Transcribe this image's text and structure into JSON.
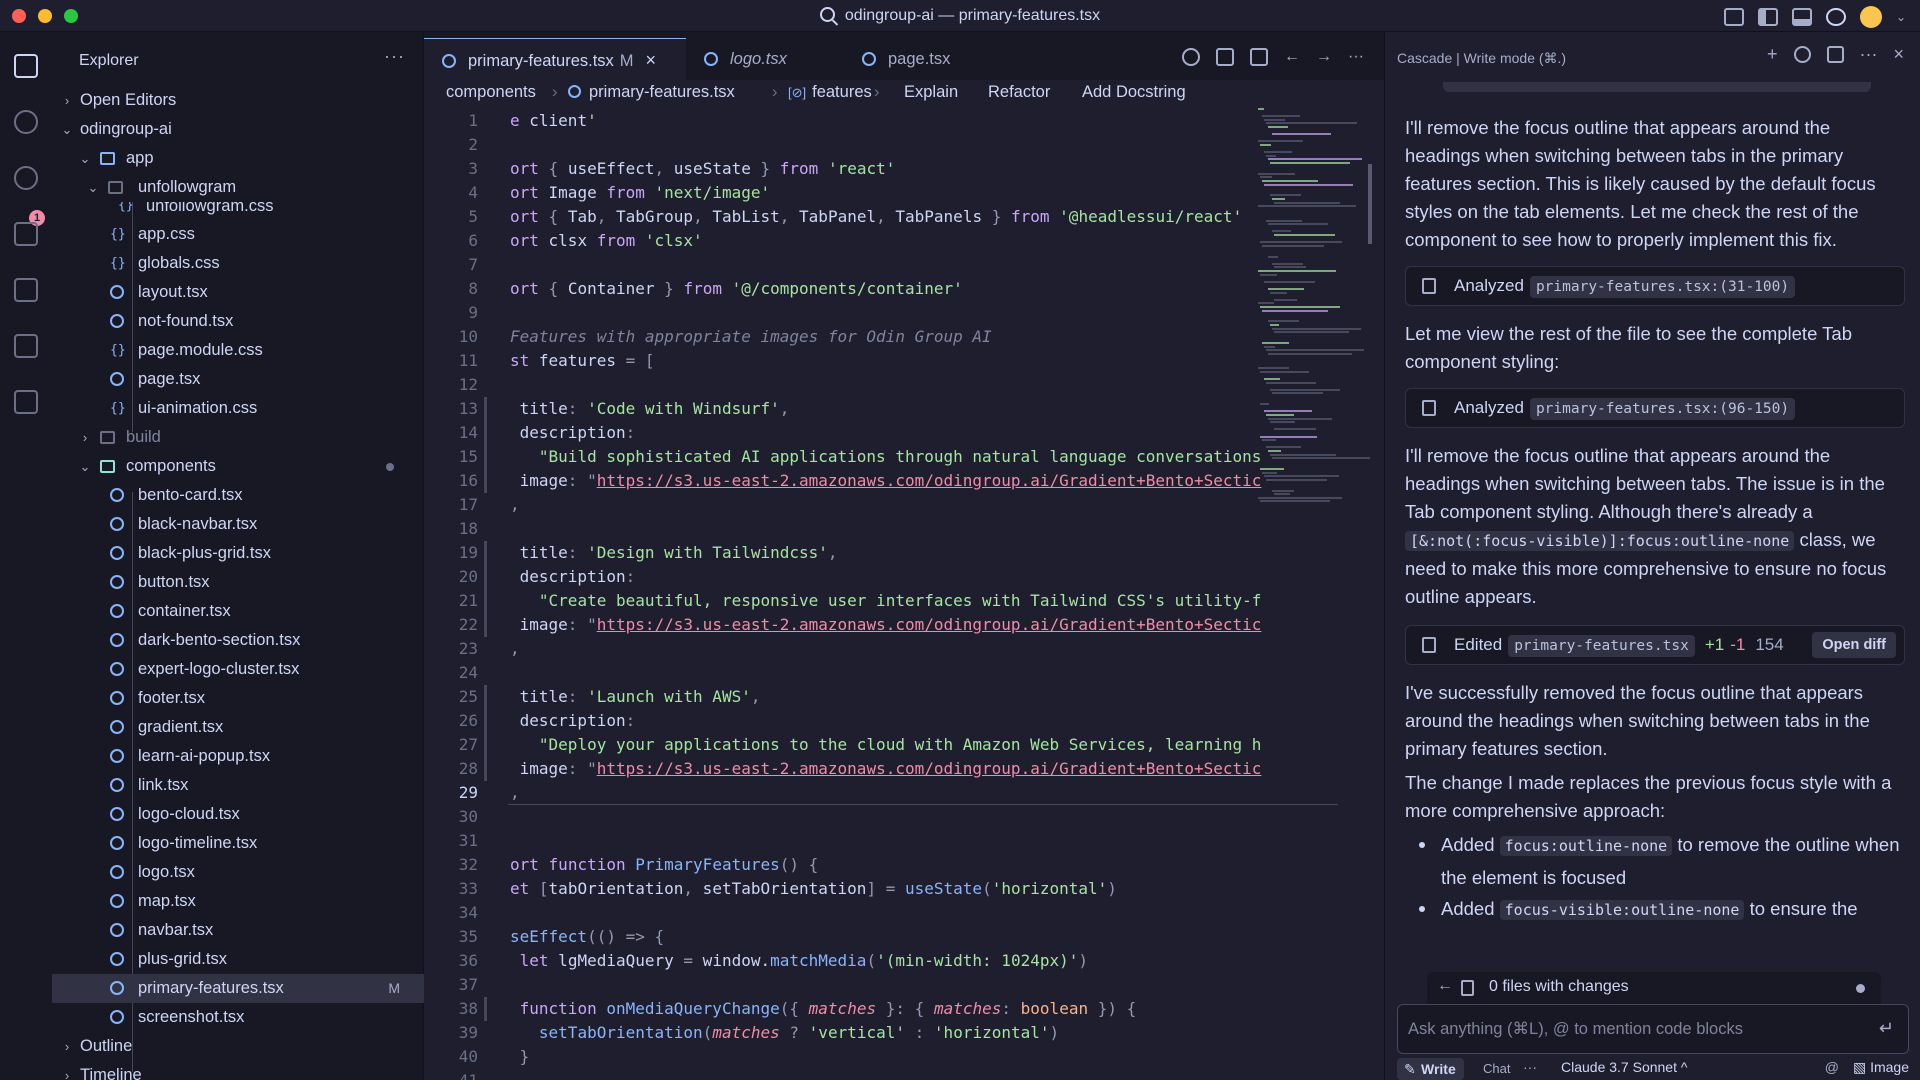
{
  "window": {
    "title": "odingroup-ai — primary-features.tsx"
  },
  "sidebar": {
    "title": "Explorer",
    "more": "···",
    "sections": {
      "open_editors": "Open Editors",
      "root": "odingroup-ai",
      "outline": "Outline",
      "timeline": "Timeline"
    },
    "tree": [
      {
        "label": "app",
        "type": "folder"
      },
      {
        "label": "unfollowgram",
        "type": "folder"
      },
      {
        "label": "unfollowgram.css",
        "type": "css"
      },
      {
        "label": "app.css",
        "type": "css"
      },
      {
        "label": "globals.css",
        "type": "css"
      },
      {
        "label": "layout.tsx",
        "type": "react"
      },
      {
        "label": "not-found.tsx",
        "type": "react"
      },
      {
        "label": "page.module.css",
        "type": "css"
      },
      {
        "label": "page.tsx",
        "type": "react"
      },
      {
        "label": "ui-animation.css",
        "type": "css"
      },
      {
        "label": "build",
        "type": "folder"
      },
      {
        "label": "components",
        "type": "folder"
      },
      {
        "label": "bento-card.tsx",
        "type": "react"
      },
      {
        "label": "black-navbar.tsx",
        "type": "react"
      },
      {
        "label": "black-plus-grid.tsx",
        "type": "react"
      },
      {
        "label": "button.tsx",
        "type": "react"
      },
      {
        "label": "container.tsx",
        "type": "react"
      },
      {
        "label": "dark-bento-section.tsx",
        "type": "react"
      },
      {
        "label": "expert-logo-cluster.tsx",
        "type": "react"
      },
      {
        "label": "footer.tsx",
        "type": "react"
      },
      {
        "label": "gradient.tsx",
        "type": "react"
      },
      {
        "label": "learn-ai-popup.tsx",
        "type": "react"
      },
      {
        "label": "link.tsx",
        "type": "react"
      },
      {
        "label": "logo-cloud.tsx",
        "type": "react"
      },
      {
        "label": "logo-timeline.tsx",
        "type": "react"
      },
      {
        "label": "logo.tsx",
        "type": "react"
      },
      {
        "label": "map.tsx",
        "type": "react"
      },
      {
        "label": "navbar.tsx",
        "type": "react"
      },
      {
        "label": "plus-grid.tsx",
        "type": "react"
      },
      {
        "label": "primary-features.tsx",
        "type": "react",
        "status": "M"
      },
      {
        "label": "screenshot.tsx",
        "type": "react"
      }
    ],
    "source_control_badge": "1"
  },
  "tabs": [
    {
      "label": "primary-features.tsx",
      "status": "M"
    },
    {
      "label": "logo.tsx"
    },
    {
      "label": "page.tsx"
    }
  ],
  "editor_actions": {
    "more": "···"
  },
  "breadcrumb": {
    "folder": "components",
    "file": "primary-features.tsx",
    "symbol": "features",
    "explain": "Explain",
    "refactor": "Refactor",
    "docstring": "Add Docstring"
  },
  "editor": {
    "current_line": 29,
    "lines": [
      "e client'",
      "",
      "ort { useEffect, useState } from 'react'",
      "ort Image from 'next/image'",
      "ort { Tab, TabGroup, TabList, TabPanel, TabPanels } from '@headlessui/react'",
      "ort clsx from 'clsx'",
      "",
      "ort { Container } from '@/components/container'",
      "",
      "Features with appropriate images for Odin Group AI",
      "st features = [",
      "",
      " title: 'Code with Windsurf',",
      " description:",
      "   \"Build sophisticated AI applications through natural language conversations",
      " image: \"https://s3.us-east-2.amazonaws.com/odingroup.ai/Gradient+Bento+Sectic",
      ",",
      "",
      " title: 'Design with Tailwindcss',",
      " description:",
      "   \"Create beautiful, responsive user interfaces with Tailwind CSS's utility-f",
      " image: \"https://s3.us-east-2.amazonaws.com/odingroup.ai/Gradient+Bento+Sectic",
      ",",
      "",
      " title: 'Launch with AWS',",
      " description:",
      "   \"Deploy your applications to the cloud with Amazon Web Services, learning h",
      " image: \"https://s3.us-east-2.amazonaws.com/odingroup.ai/Gradient+Bento+Sectic",
      ",",
      "",
      "",
      "ort function PrimaryFeatures() {",
      "et [tabOrientation, setTabOrientation] = useState('horizontal')",
      "",
      "seEffect(() => {",
      " let lgMediaQuery = window.matchMedia('(min-width: 1024px)')",
      "",
      " function onMediaQueryChange({ matches }: { matches: boolean }) {",
      "   setTabOrientation(matches ? 'vertical' : 'horizontal')",
      " }",
      ""
    ]
  },
  "cascade": {
    "header": "Cascade | Write mode (⌘.)",
    "messages": {
      "m1": "I'll remove the focus outline that appears around the headings when switching between tabs in the primary features section. This is likely caused by the default focus styles on the tab elements. Let me check the rest of the component to see how to properly implement this fix.",
      "step1_label": "Analyzed",
      "step1_file": "primary-features.tsx:(31-100)",
      "m2": "Let me view the rest of the file to see the complete Tab component styling:",
      "step2_label": "Analyzed",
      "step2_file": "primary-features.tsx:(96-150)",
      "m3a": "I'll remove the focus outline that appears around the headings when switching between tabs. The issue is in the Tab component styling. Although there's already a",
      "m3_code": "[&:not(:focus-visible)]:focus:outline-none",
      "m3b": "class, we need to make this more comprehensive to ensure no focus outline appears.",
      "edit_label": "Edited",
      "edit_file": "primary-features.tsx",
      "edit_add": "+1",
      "edit_del": "-1",
      "edit_count": "154",
      "open_diff": "Open diff",
      "m4": "I've successfully removed the focus outline that appears around the headings when switching between tabs in the primary features section.",
      "m5": "The change I made replaces the previous focus style with a more comprehensive approach:",
      "b1_pre": "Added",
      "b1_code": "focus:outline-none",
      "b1_post": "to remove the outline when the element is focused",
      "b2_pre": "Added",
      "b2_code": "focus-visible:outline-none",
      "b2_post": "to ensure the"
    },
    "files_bar": "0 files with changes",
    "input_placeholder": "Ask anything (⌘L), @ to mention code blocks",
    "footer": {
      "write": "Write",
      "chat": "Chat",
      "more": "···",
      "model": "Claude 3.7 Sonnet ^",
      "image": "Image"
    }
  }
}
